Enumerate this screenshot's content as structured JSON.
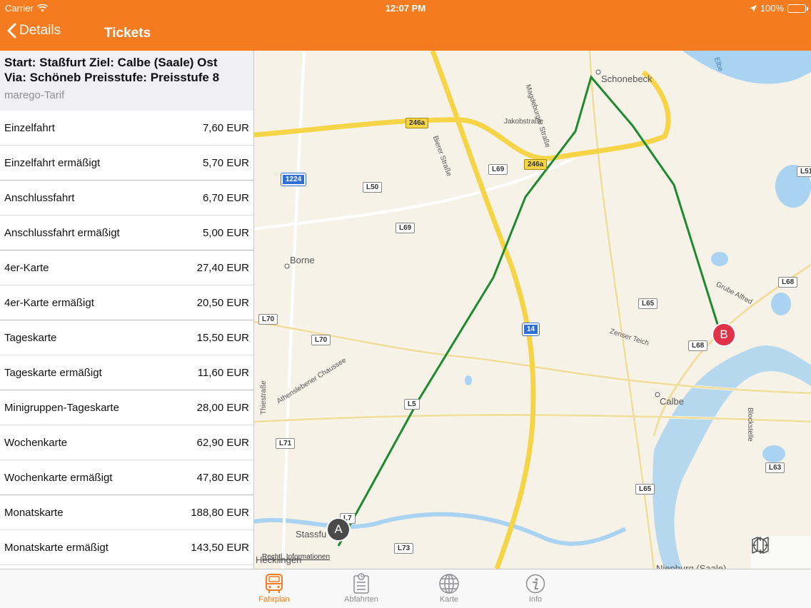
{
  "status": {
    "carrier": "Carrier",
    "time": "12:07 PM",
    "battery": "100%"
  },
  "nav": {
    "back_label": "Details",
    "title": "Tickets"
  },
  "route": {
    "line1": "Start: Staßfurt Ziel: Calbe (Saale) Ost",
    "line2": "Via: Schöneb Preisstufe: Preisstufe 8",
    "tarif": "marego-Tarif"
  },
  "tickets": [
    {
      "name": "Einzelfahrt",
      "price": "7,60 EUR"
    },
    {
      "name": "Einzelfahrt ermäßigt",
      "price": "5,70 EUR"
    },
    {
      "name": "Anschlussfahrt",
      "price": "6,70 EUR"
    },
    {
      "name": "Anschlussfahrt ermäßigt",
      "price": "5,00 EUR"
    },
    {
      "name": "4er-Karte",
      "price": "27,40 EUR"
    },
    {
      "name": "4er-Karte ermäßigt",
      "price": "20,50 EUR"
    },
    {
      "name": "Tageskarte",
      "price": "15,50 EUR"
    },
    {
      "name": "Tageskarte ermäßigt",
      "price": "11,60 EUR"
    },
    {
      "name": "Minigruppen-Tageskarte",
      "price": "28,00 EUR"
    },
    {
      "name": "Wochenkarte",
      "price": "62,90 EUR"
    },
    {
      "name": "Wochenkarte ermäßigt",
      "price": "47,80 EUR"
    },
    {
      "name": "Monatskarte",
      "price": "188,80 EUR"
    },
    {
      "name": "Monatskarte ermäßigt",
      "price": "143,50 EUR"
    }
  ],
  "map": {
    "places": {
      "schonebeck": "Schonebeck",
      "borne": "Borne",
      "calbe": "Calbe",
      "stassfurt": "Stassfu",
      "hecklingen": "Hecklingen",
      "nienburg": "Nienburg (Saale)",
      "jakobstrasse": "Jakobstraße",
      "magdeburger": "Magdeburger Straße",
      "bierer": "Bierer Straße",
      "athensleben": "Athenslebener Chaussee",
      "zenser": "Zenser Teich",
      "grube": "Grube Alfred",
      "blockstelle": "Blockstelle",
      "thiestrasse": "Thiestraße",
      "elbe": "Elbe"
    },
    "shields": {
      "r246a_1": "246a",
      "r246a_2": "246a",
      "r1224": "1224",
      "l50": "L50",
      "l69a": "L69",
      "l69b": "L69",
      "l70a": "L70",
      "l70b": "L70",
      "l65a": "L65",
      "l65b": "L65",
      "l68a": "L68",
      "l68b": "L68",
      "a14": "14",
      "l51": "L51",
      "l5x": "L5",
      "l71": "L71",
      "l72": "L7",
      "l73": "L73",
      "l63": "L63"
    },
    "pin_a": "A",
    "pin_b": "B",
    "legal": "Rechtl. Informationen",
    "route_color": "#1e8a2e"
  },
  "tabs": [
    {
      "label": "Fahrplan",
      "active": true
    },
    {
      "label": "Abfahrten",
      "active": false
    },
    {
      "label": "Karte",
      "active": false
    },
    {
      "label": "Info",
      "active": false
    }
  ],
  "colors": {
    "accent": "#f47b20",
    "pin_a": "#4a4a4a",
    "pin_b": "#e0334a"
  }
}
